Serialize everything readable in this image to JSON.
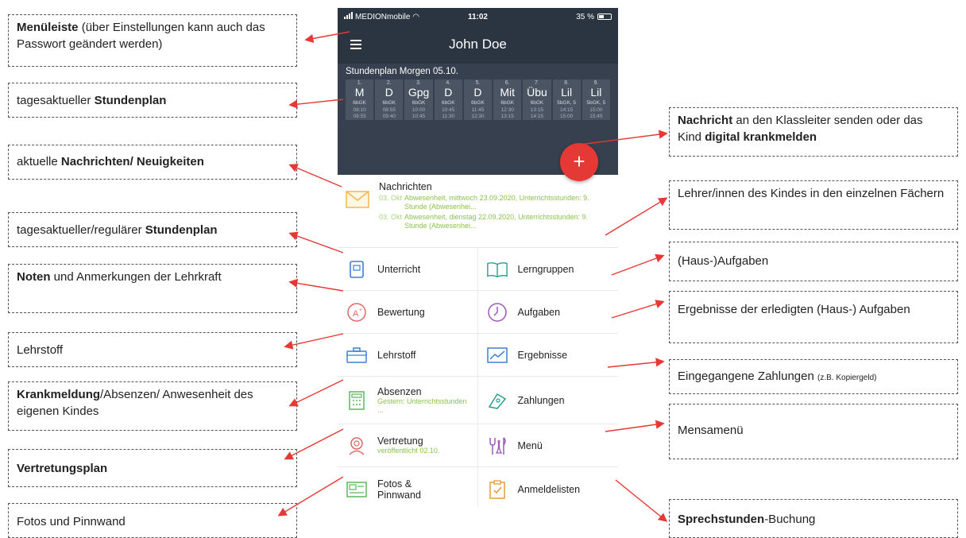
{
  "callouts": {
    "c1_bold": "Menüleiste",
    "c1_text": " (über Einstellungen kann auch das Passwort geändert werden)",
    "c2_text": "tagesaktueller ",
    "c2_bold": "Stundenplan",
    "c3_text": "aktuelle ",
    "c3_bold": "Nachrichten/ Neuigkeiten",
    "c4_text": "tagesaktueller/regulärer ",
    "c4_bold": "Stundenplan",
    "c5_bold": "Noten",
    "c5_text": " und Anmerkungen der Lehrkraft",
    "c6_text": "Lehrstoff",
    "c7_bold": "Krankmeldung",
    "c7_text": "/Absenzen/ Anwesenheit des eigenen Kindes",
    "c8_bold": "Vertretungsplan",
    "c9_text": "Fotos und Pinnwand",
    "r1_bold1": "Nachricht",
    "r1_text1": " an den Klassleiter senden oder das Kind ",
    "r1_bold2": "digital krankmelden",
    "r2_text": "Lehrer/innen des Kindes in den einzelnen Fächern",
    "r3_text": "(Haus-)Aufgaben",
    "r4_text": "Ergebnisse der erledigten (Haus-) Aufgaben",
    "r5_text": "Eingegangene Zahlungen ",
    "r5_small": "(z.B. Kopiergeld)",
    "r6_text": "Mensamenü",
    "r7_bold": "Sprechstunden",
    "r7_text": "-Buchung"
  },
  "status": {
    "carrier": "MEDIONmobile",
    "time": "11:02",
    "battery": "35 %"
  },
  "app": {
    "title": "John Doe"
  },
  "schedule": {
    "title": "Stundenplan Morgen 05.10.",
    "periods": [
      {
        "num": "1.",
        "subject": "M",
        "class": "6bGK",
        "start": "08:10",
        "end": "08:55"
      },
      {
        "num": "2.",
        "subject": "D",
        "class": "6bGK",
        "start": "08:55",
        "end": "09:40"
      },
      {
        "num": "3.",
        "subject": "Gpg",
        "class": "6bGK",
        "start": "10:00",
        "end": "10:45"
      },
      {
        "num": "4.",
        "subject": "D",
        "class": "6bGK",
        "start": "10:45",
        "end": "11:30"
      },
      {
        "num": "5.",
        "subject": "D",
        "class": "6bGK",
        "start": "11:45",
        "end": "12:30"
      },
      {
        "num": "6.",
        "subject": "Mit",
        "class": "6bGK",
        "start": "12:30",
        "end": "13:15"
      },
      {
        "num": "7.",
        "subject": "Übu",
        "class": "6bGK",
        "start": "13:15",
        "end": "14:15"
      },
      {
        "num": "8.",
        "subject": "Lil",
        "class": "5bGK, 5",
        "start": "14:15",
        "end": "15:00"
      },
      {
        "num": "9.",
        "subject": "Lil",
        "class": "5bGK, 5",
        "start": "15:00",
        "end": "15:45"
      }
    ]
  },
  "fab": "+",
  "news": {
    "title": "Nachrichten",
    "items": [
      {
        "date": "03. Okt",
        "text": "Abwesenheit, mittwoch 23.09.2020, Unterrichtsstunden: 9. Stunde (Abwesenhei..."
      },
      {
        "date": "03. Okt",
        "text": "Abwesenheit, dienstag 22.09.2020, Unterrichtsstunden: 9. Stunde (Abwesenhei..."
      }
    ]
  },
  "tiles": {
    "unterricht": "Unterricht",
    "lerngruppen": "Lerngruppen",
    "bewertung": "Bewertung",
    "aufgaben": "Aufgaben",
    "lehrstoff": "Lehrstoff",
    "ergebnisse": "Ergebnisse",
    "absenzen": "Absenzen",
    "absenzen_sub": "Gestern: Unterrichtsstunden ...",
    "zahlungen": "Zahlungen",
    "vertretung": "Vertretung",
    "vertretung_sub": "veröffentlicht 02.10.",
    "menu": "Menü",
    "fotos": "Fotos & Pinnwand",
    "anmeldelisten": "Anmeldelisten"
  },
  "colors": {
    "appbar": "#2b3441",
    "schedule": "#36404e",
    "fab": "#e53935",
    "arrow": "#e53935",
    "accent_green": "#8bc34a"
  }
}
